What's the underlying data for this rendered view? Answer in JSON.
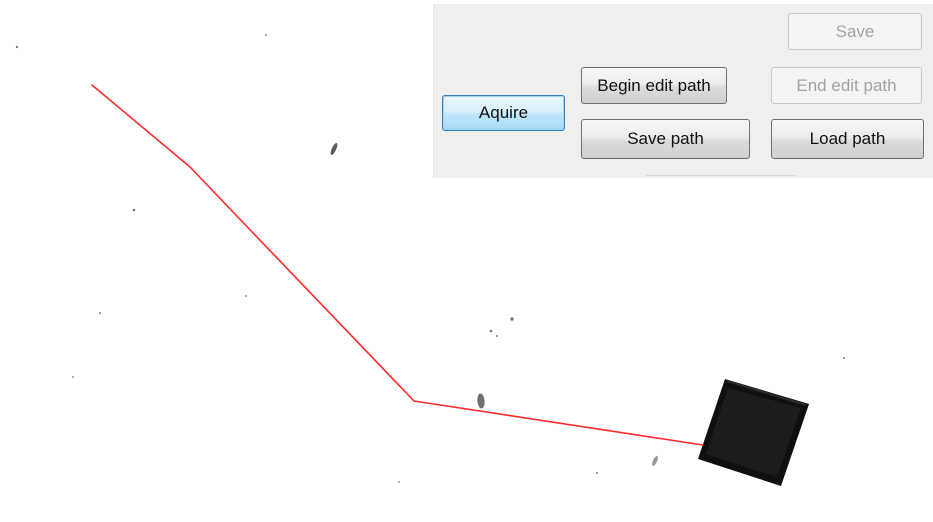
{
  "panel": {
    "buttons": {
      "save": "Save",
      "aquire": "Aquire",
      "begin_edit_path": "Begin edit path",
      "end_edit_path": "End edit path",
      "save_path": "Save path",
      "load_path": "Load path"
    }
  },
  "overlay": {
    "path_color": "#ff2a2a"
  }
}
